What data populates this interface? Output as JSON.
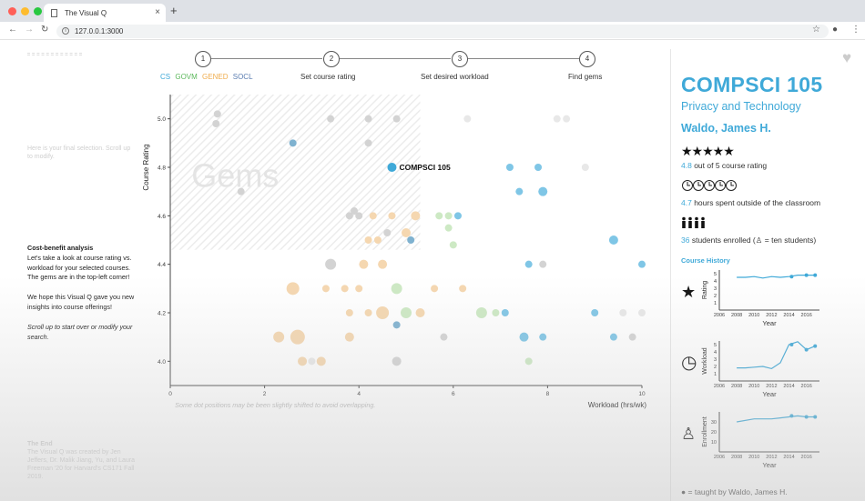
{
  "browser": {
    "tab_title": "The Visual Q",
    "tab_close": "×",
    "new_tab": "+",
    "url": "127.0.0.1:3000",
    "dot_colors": [
      "#ff5f57",
      "#febc2e",
      "#28c840"
    ]
  },
  "left": {
    "faded_intro": "Here is your final selection. Scroll up to modify.",
    "cb_title": "Cost-benefit analysis",
    "cb_para1": "Let's take a look at course rating vs. workload for your selected courses. The gems are in the top-left corner!",
    "cb_para2": "We hope this Visual Q gave you new insights into course offerings!",
    "cb_para3": "Scroll up to start over or modify your search.",
    "end_title": "The End",
    "end_text": "The Visual Q was created by Jen Jeffers, Dr. Malik Jiang, Yu, and Laura Freeman '20 for Harvard's CS171 Fall 2019."
  },
  "steps": {
    "items": [
      {
        "num": "1",
        "label": ""
      },
      {
        "num": "2",
        "label": "Set course rating"
      },
      {
        "num": "3",
        "label": "Set desired workload"
      },
      {
        "num": "4",
        "label": "Find gems"
      }
    ],
    "depts": [
      {
        "text": "CS",
        "color": "#3fa9d8"
      },
      {
        "text": "GOVM",
        "color": "#5cb85c"
      },
      {
        "text": "GENED",
        "color": "#f0ad4e"
      },
      {
        "text": "SOCL",
        "color": "#5b7db1"
      }
    ]
  },
  "chart_data": {
    "type": "scatter",
    "ylabel": "Course Rating",
    "xlabel": "Workload (hrs/wk)",
    "xlim": [
      0,
      10
    ],
    "ylim": [
      3.9,
      5.1
    ],
    "x_ticks": [
      "0",
      "2",
      "4",
      "6",
      "8",
      "10"
    ],
    "y_ticks": [
      "4.0",
      "4.2",
      "4.4",
      "4.6",
      "4.8",
      "5.0"
    ],
    "gems_label": "Gems",
    "footnote": "Some dot positions may be been slightly shifted to avoid overlapping.",
    "highlight_label": "COMPSCI 105",
    "highlight": {
      "x": 4.7,
      "y": 4.8
    },
    "points": [
      {
        "x": 1.0,
        "y": 5.02,
        "r": 4,
        "c": "#d3d3d3"
      },
      {
        "x": 0.97,
        "y": 4.98,
        "r": 4,
        "c": "#d3d3d3"
      },
      {
        "x": 3.4,
        "y": 5.0,
        "r": 4,
        "c": "#d3d3d3"
      },
      {
        "x": 4.2,
        "y": 5.0,
        "r": 4,
        "c": "#d3d3d3"
      },
      {
        "x": 4.8,
        "y": 5.0,
        "r": 4,
        "c": "#d3d3d3"
      },
      {
        "x": 6.3,
        "y": 5.0,
        "r": 4,
        "c": "#e8e8e8"
      },
      {
        "x": 8.2,
        "y": 5.0,
        "r": 4,
        "c": "#e8e8e8"
      },
      {
        "x": 8.4,
        "y": 5.0,
        "r": 4,
        "c": "#e8e8e8"
      },
      {
        "x": 2.6,
        "y": 4.9,
        "r": 4,
        "c": "#7fb2d0"
      },
      {
        "x": 4.2,
        "y": 4.9,
        "r": 4,
        "c": "#d3d3d3"
      },
      {
        "x": 7.2,
        "y": 4.8,
        "r": 4,
        "c": "#7fc6e6"
      },
      {
        "x": 7.8,
        "y": 4.8,
        "r": 4,
        "c": "#7fc6e6"
      },
      {
        "x": 8.8,
        "y": 4.8,
        "r": 4,
        "c": "#e8e8e8"
      },
      {
        "x": 1.5,
        "y": 4.7,
        "r": 4,
        "c": "#d3d3d3"
      },
      {
        "x": 7.4,
        "y": 4.7,
        "r": 4,
        "c": "#7fc6e6"
      },
      {
        "x": 7.9,
        "y": 4.7,
        "r": 5,
        "c": "#7fc6e6"
      },
      {
        "x": 3.8,
        "y": 4.6,
        "r": 4,
        "c": "#d3d3d3"
      },
      {
        "x": 3.9,
        "y": 4.62,
        "r": 4,
        "c": "#d3d3d3"
      },
      {
        "x": 4.0,
        "y": 4.6,
        "r": 4,
        "c": "#d3d3d3"
      },
      {
        "x": 4.3,
        "y": 4.6,
        "r": 4,
        "c": "#f5d7b0"
      },
      {
        "x": 4.7,
        "y": 4.6,
        "r": 4,
        "c": "#f5d7b0"
      },
      {
        "x": 5.2,
        "y": 4.6,
        "r": 5,
        "c": "#f5d7b0"
      },
      {
        "x": 5.7,
        "y": 4.6,
        "r": 4,
        "c": "#cde9c4"
      },
      {
        "x": 5.9,
        "y": 4.6,
        "r": 4,
        "c": "#cde9c4"
      },
      {
        "x": 6.1,
        "y": 4.6,
        "r": 4,
        "c": "#7fc6e6"
      },
      {
        "x": 4.6,
        "y": 4.53,
        "r": 4,
        "c": "#d3d3d3"
      },
      {
        "x": 5.0,
        "y": 4.53,
        "r": 5,
        "c": "#f5d7b0"
      },
      {
        "x": 5.9,
        "y": 4.55,
        "r": 4,
        "c": "#cde9c4"
      },
      {
        "x": 4.4,
        "y": 4.5,
        "r": 4,
        "c": "#f5d7b0"
      },
      {
        "x": 4.2,
        "y": 4.5,
        "r": 4,
        "c": "#f5d7b0"
      },
      {
        "x": 5.1,
        "y": 4.5,
        "r": 4,
        "c": "#7fb2d0"
      },
      {
        "x": 6.0,
        "y": 4.48,
        "r": 4,
        "c": "#cde9c4"
      },
      {
        "x": 9.4,
        "y": 4.5,
        "r": 5,
        "c": "#7fc6e6"
      },
      {
        "x": 3.4,
        "y": 4.4,
        "r": 6,
        "c": "#d3d3d3"
      },
      {
        "x": 4.1,
        "y": 4.4,
        "r": 5,
        "c": "#f5d7b0"
      },
      {
        "x": 4.5,
        "y": 4.4,
        "r": 5,
        "c": "#f5d7b0"
      },
      {
        "x": 7.6,
        "y": 4.4,
        "r": 4,
        "c": "#7fc6e6"
      },
      {
        "x": 7.9,
        "y": 4.4,
        "r": 4,
        "c": "#d3d3d3"
      },
      {
        "x": 10.0,
        "y": 4.4,
        "r": 4,
        "c": "#7fc6e6"
      },
      {
        "x": 2.6,
        "y": 4.3,
        "r": 7,
        "c": "#f5d7b0"
      },
      {
        "x": 3.3,
        "y": 4.3,
        "r": 4,
        "c": "#f5d7b0"
      },
      {
        "x": 3.7,
        "y": 4.3,
        "r": 4,
        "c": "#f5d7b0"
      },
      {
        "x": 4.0,
        "y": 4.3,
        "r": 4,
        "c": "#f5d7b0"
      },
      {
        "x": 4.8,
        "y": 4.3,
        "r": 6,
        "c": "#cde9c4"
      },
      {
        "x": 5.6,
        "y": 4.3,
        "r": 4,
        "c": "#f5d7b0"
      },
      {
        "x": 6.2,
        "y": 4.3,
        "r": 4,
        "c": "#f5d7b0"
      },
      {
        "x": 3.8,
        "y": 4.2,
        "r": 4,
        "c": "#f5d7b0"
      },
      {
        "x": 4.2,
        "y": 4.2,
        "r": 4,
        "c": "#f5d7b0"
      },
      {
        "x": 4.5,
        "y": 4.2,
        "r": 7,
        "c": "#f5d7b0"
      },
      {
        "x": 5.0,
        "y": 4.2,
        "r": 6,
        "c": "#cde9c4"
      },
      {
        "x": 5.3,
        "y": 4.2,
        "r": 5,
        "c": "#f5d7b0"
      },
      {
        "x": 6.6,
        "y": 4.2,
        "r": 6,
        "c": "#cde9c4"
      },
      {
        "x": 6.9,
        "y": 4.2,
        "r": 4,
        "c": "#cde9c4"
      },
      {
        "x": 7.1,
        "y": 4.2,
        "r": 4,
        "c": "#7fc6e6"
      },
      {
        "x": 9.0,
        "y": 4.2,
        "r": 4,
        "c": "#7fc6e6"
      },
      {
        "x": 9.6,
        "y": 4.2,
        "r": 4,
        "c": "#e8e8e8"
      },
      {
        "x": 10.0,
        "y": 4.2,
        "r": 4,
        "c": "#e8e8e8"
      },
      {
        "x": 4.8,
        "y": 4.15,
        "r": 4,
        "c": "#7fb2d0"
      },
      {
        "x": 2.7,
        "y": 4.1,
        "r": 8,
        "c": "#f5d7b0"
      },
      {
        "x": 2.3,
        "y": 4.1,
        "r": 6,
        "c": "#f5d7b0"
      },
      {
        "x": 3.8,
        "y": 4.1,
        "r": 5,
        "c": "#f5d7b0"
      },
      {
        "x": 5.8,
        "y": 4.1,
        "r": 4,
        "c": "#d3d3d3"
      },
      {
        "x": 7.5,
        "y": 4.1,
        "r": 5,
        "c": "#7fc6e6"
      },
      {
        "x": 7.9,
        "y": 4.1,
        "r": 4,
        "c": "#7fc6e6"
      },
      {
        "x": 9.4,
        "y": 4.1,
        "r": 4,
        "c": "#7fc6e6"
      },
      {
        "x": 9.8,
        "y": 4.1,
        "r": 4,
        "c": "#d3d3d3"
      },
      {
        "x": 2.8,
        "y": 4.0,
        "r": 5,
        "c": "#f5d7b0"
      },
      {
        "x": 3.2,
        "y": 4.0,
        "r": 5,
        "c": "#f5d7b0"
      },
      {
        "x": 4.8,
        "y": 4.0,
        "r": 5,
        "c": "#d3d3d3"
      },
      {
        "x": 3.0,
        "y": 4.0,
        "r": 4,
        "c": "#e8e8e8"
      },
      {
        "x": 7.6,
        "y": 4.0,
        "r": 4,
        "c": "#cde9c4"
      }
    ]
  },
  "panel": {
    "course_code": "COMPSCI 105",
    "course_title": "Privacy and Technology",
    "instructor": "Waldo, James H.",
    "stars": "★★★★★",
    "rating_value": "4.8",
    "rating_text": " out of 5 course rating",
    "hours_value": "4.7",
    "hours_text": " hours spent outside of the classroom",
    "enroll_value": "36",
    "enroll_text": " students enrolled (",
    "enroll_text2": " = ten students)",
    "history_label": "Course History",
    "legend_text": " = taught by ",
    "legend_name": "Waldo, James H.",
    "accent": "#3fa9d8",
    "history_x": [
      "2006",
      "2008",
      "2010",
      "2012",
      "2014",
      "2016"
    ],
    "history_xlabel": "Year",
    "mini_charts": [
      {
        "ylabel": "Rating",
        "yticks": [
          "1",
          "2",
          "3",
          "4",
          "5"
        ],
        "ylim": [
          0,
          5.5
        ],
        "line": [
          [
            2008,
            4.5
          ],
          [
            2009,
            4.5
          ],
          [
            2010,
            4.6
          ],
          [
            2011,
            4.4
          ],
          [
            2012,
            4.6
          ],
          [
            2013,
            4.5
          ],
          [
            2014,
            4.6
          ],
          [
            2015,
            4.8
          ],
          [
            2016,
            4.8
          ],
          [
            2017,
            4.8
          ]
        ],
        "dots": [
          [
            2014.3,
            4.6
          ],
          [
            2016,
            4.8
          ],
          [
            2017,
            4.8
          ]
        ]
      },
      {
        "ylabel": "Workload",
        "yticks": [
          "1",
          "2",
          "3",
          "4",
          "5"
        ],
        "ylim": [
          0,
          5.5
        ],
        "line": [
          [
            2008,
            1.8
          ],
          [
            2009,
            1.8
          ],
          [
            2010,
            1.9
          ],
          [
            2011,
            2.0
          ],
          [
            2012,
            1.7
          ],
          [
            2013,
            2.5
          ],
          [
            2014,
            5.0
          ],
          [
            2015,
            5.4
          ],
          [
            2016,
            4.3
          ],
          [
            2017,
            4.8
          ]
        ],
        "dots": [
          [
            2014.3,
            5.0
          ],
          [
            2016,
            4.3
          ],
          [
            2017,
            4.8
          ]
        ]
      },
      {
        "ylabel": "Enrollment",
        "yticks": [
          "10",
          "20",
          "30"
        ],
        "ylim": [
          0,
          40
        ],
        "line": [
          [
            2008,
            30
          ],
          [
            2010,
            33
          ],
          [
            2012,
            33
          ],
          [
            2013,
            34
          ],
          [
            2014,
            35
          ],
          [
            2015,
            36
          ],
          [
            2016,
            35
          ],
          [
            2017,
            35
          ]
        ],
        "dots": [
          [
            2014.3,
            36
          ],
          [
            2016,
            35
          ],
          [
            2017,
            35
          ]
        ]
      }
    ]
  }
}
